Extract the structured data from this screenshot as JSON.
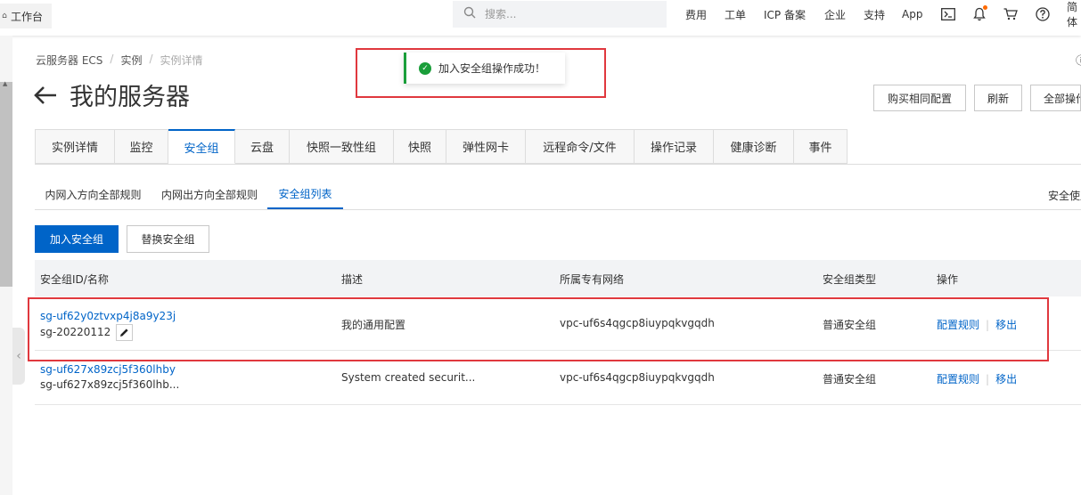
{
  "topbar": {
    "workbench_label": "工作台",
    "search_placeholder": "搜索...",
    "nav": [
      "费用",
      "工单",
      "ICP 备案",
      "企业",
      "支持",
      "App"
    ],
    "lang_label": "简体"
  },
  "breadcrumb": [
    "云服务器 ECS",
    "实例",
    "实例详情"
  ],
  "page_title": "我的服务器",
  "actions": {
    "buy_same": "购买相同配置",
    "refresh": "刷新",
    "all_ops": "全部操作"
  },
  "far_right_top": "ⓘ",
  "toast": {
    "message": "加入安全组操作成功！"
  },
  "tabs": [
    "实例详情",
    "监控",
    "安全组",
    "云盘",
    "快照一致性组",
    "快照",
    "弹性网卡",
    "远程命令/文件",
    "操作记录",
    "健康诊断",
    "事件"
  ],
  "active_tab": "安全组",
  "subtabs": [
    "内网入方向全部规则",
    "内网出方向全部规则",
    "安全组列表"
  ],
  "active_subtab": "安全组列表",
  "right_label": "安全使用",
  "buttons": {
    "join_sg": "加入安全组",
    "replace_sg": "替换安全组"
  },
  "table": {
    "headers": [
      "安全组ID/名称",
      "描述",
      "所属专有网络",
      "安全组类型",
      "操作"
    ],
    "rows": [
      {
        "id": "sg-uf62y0ztvxp4j8a9y23j",
        "name": "sg-20220112",
        "desc": "我的通用配置",
        "vpc": "vpc-uf6s4qgcp8iuypqkvgqdh",
        "type": "普通安全组",
        "op1": "配置规则",
        "op2": "移出"
      },
      {
        "id": "sg-uf627x89zcj5f360lhby",
        "name": "sg-uf627x89zcj5f360lhb...",
        "desc": "System created securit...",
        "vpc": "vpc-uf6s4qgcp8iuypqkvgqdh",
        "type": "普通安全组",
        "op1": "配置规则",
        "op2": "移出"
      }
    ]
  },
  "colors": {
    "accent": "#0064c8",
    "success": "#1a9e3a",
    "highlight": "#e0383e"
  }
}
